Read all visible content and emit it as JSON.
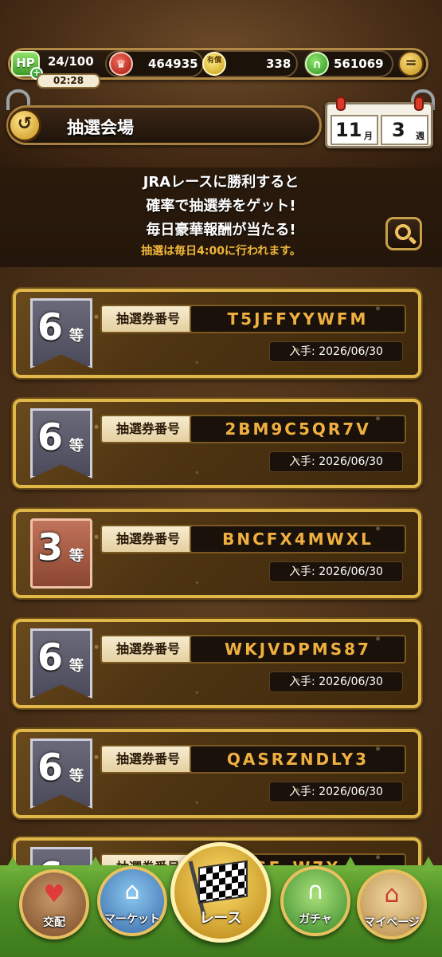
{
  "status": {
    "hp_badge": "HP",
    "hp_plus": "+",
    "hp": "24/100",
    "hp_timer": "02:28",
    "red_coin_value": "464935",
    "gold_coin_label": "有償",
    "gold_coin_value": "338",
    "green_coin_value": "561069",
    "menu_glyph": "="
  },
  "header": {
    "back_glyph": "↺",
    "title": "抽選会場",
    "calendar_month": "11",
    "calendar_month_unit": "月",
    "calendar_week": "3",
    "calendar_week_unit": "週"
  },
  "info": {
    "line1": "JRAレースに勝利すると",
    "line2": "確率で抽選券をゲット!",
    "line3": "毎日豪華報酬が当たる!",
    "note": "抽選は毎日4:00に行われます。"
  },
  "tickets": [
    {
      "rank": "6",
      "rank_suffix": "等",
      "label": "抽選券番号",
      "code": "T5JFFYYWFM",
      "date": "入手: 2026/06/30"
    },
    {
      "rank": "6",
      "rank_suffix": "等",
      "label": "抽選券番号",
      "code": "2BM9C5QR7V",
      "date": "入手: 2026/06/30"
    },
    {
      "rank": "3",
      "rank_suffix": "等",
      "label": "抽選券番号",
      "code": "BNCFX4MWXL",
      "date": "入手: 2026/06/30"
    },
    {
      "rank": "6",
      "rank_suffix": "等",
      "label": "抽選券番号",
      "code": "WKJVDPMS87",
      "date": "入手: 2026/06/30"
    },
    {
      "rank": "6",
      "rank_suffix": "等",
      "label": "抽選券番号",
      "code": "QASRZNDLY3",
      "date": "入手: 2026/06/30"
    },
    {
      "rank": "6",
      "rank_suffix": "等",
      "label": "抽選券番号",
      "code": "SF_W7X",
      "date": ""
    }
  ],
  "nav": {
    "breed": "交配",
    "market": "マーケット",
    "race": "レース",
    "gacha": "ガチャ",
    "mypage": "マイページ"
  },
  "colors": {
    "gold_border": "#e0b84a",
    "code_text": "#f0b040",
    "note_text": "#f0b63a",
    "grass": "#4f8f26"
  },
  "icons": {
    "hp": "hp-badge-icon",
    "red_coin": "red-coin-icon",
    "gold_coin": "gold-coin-icon",
    "green_coin": "horseshoe-coin-icon",
    "menu": "menu-icon",
    "back": "back-arrow-icon",
    "calendar": "calendar-icon",
    "search": "magnifier-icon",
    "breed": "heart-horses-icon",
    "market": "shop-icon",
    "race": "checkered-flag-icon",
    "gacha": "horseshoe-icon",
    "mypage": "house-icon"
  }
}
